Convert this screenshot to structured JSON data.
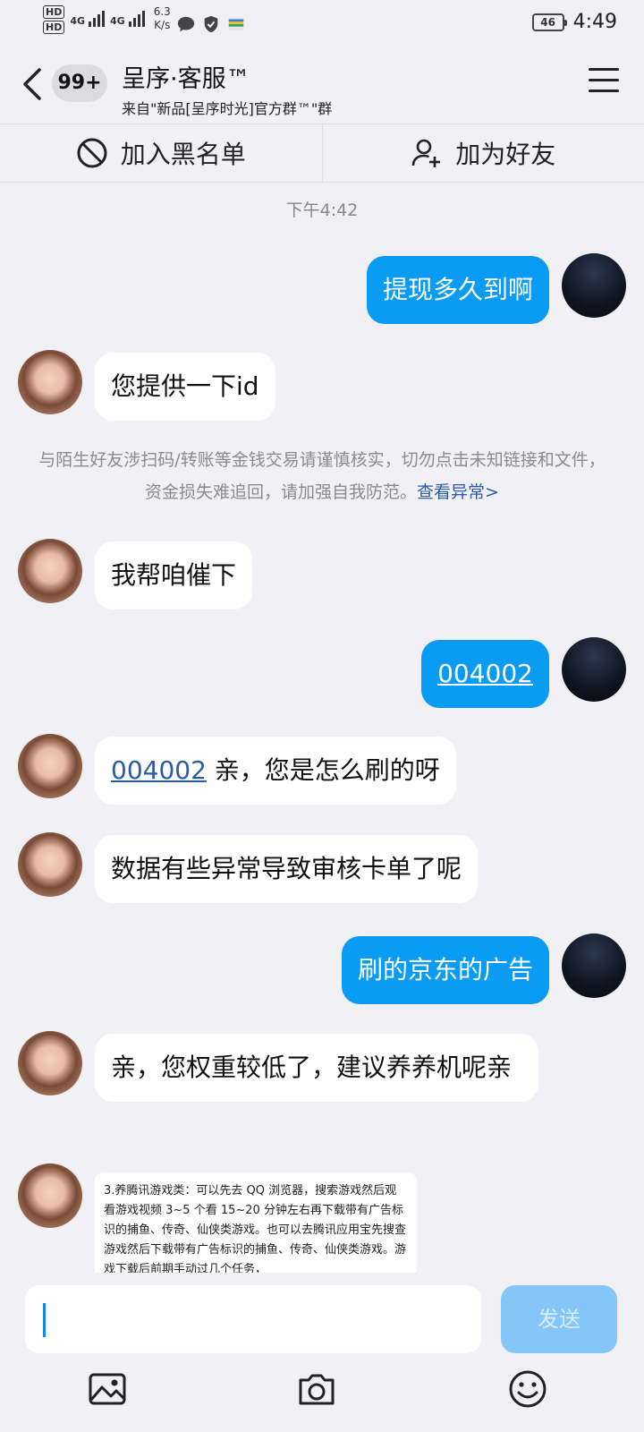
{
  "status_bar": {
    "hd1": "HD",
    "hd2": "HD",
    "net1": "4G",
    "net2": "4G",
    "speed_value": "6.3",
    "speed_unit": "K/s",
    "battery": "46",
    "time": "4:49"
  },
  "header": {
    "badge": "99+",
    "title": "呈序·客服™",
    "subtitle": "来自\"新品[呈序时光]官方群™\"群"
  },
  "actions": {
    "blacklist": "加入黑名单",
    "add_friend": "加为好友"
  },
  "chat": {
    "timestamp": "下午4:42",
    "messages": [
      {
        "side": "out",
        "text": "提现多久到啊"
      },
      {
        "side": "in",
        "text": "您提供一下id"
      },
      {
        "side": "in",
        "text": "我帮咱催下"
      },
      {
        "side": "out",
        "text": "004002"
      },
      {
        "side": "in",
        "link": "004002",
        "text": " 亲，您是怎么刷的呀"
      },
      {
        "side": "in",
        "text": "数据有些异常导致审核卡单了呢"
      },
      {
        "side": "out",
        "text": "刷的京东的广告"
      },
      {
        "side": "in",
        "text": "亲，您权重较低了，建议养养机呢亲"
      }
    ],
    "notice": {
      "text": "与陌生好友涉扫码/转账等金钱交易请谨慎核实，切勿点击未知链接和文件，资金损失难追回，请加强自我防范。",
      "link": "查看异常>"
    },
    "image_message": {
      "text": "3.养腾讯游戏类：可以先去 QQ 浏览器，搜索游戏然后观看游戏视频 3~5 个看 15~20 分钟左右再下载带有广告标识的捕鱼、传奇、仙侠类游戏。也可以去腾讯应用宝先搜查游戏然后下载带有广告标识的捕鱼、传奇、仙侠类游戏。游戏下载后前期手动过几个任务，"
    }
  },
  "input": {
    "value": "",
    "send_label": "发送"
  },
  "toolbar": {
    "icons": [
      "image-icon",
      "camera-icon",
      "emoji-icon"
    ]
  },
  "colors": {
    "outgoing_bubble": "#0a9bf5",
    "incoming_bubble": "#ffffff",
    "background": "#f1f1f5",
    "send_disabled": "#84c6f7",
    "link": "#2a5aa8"
  }
}
